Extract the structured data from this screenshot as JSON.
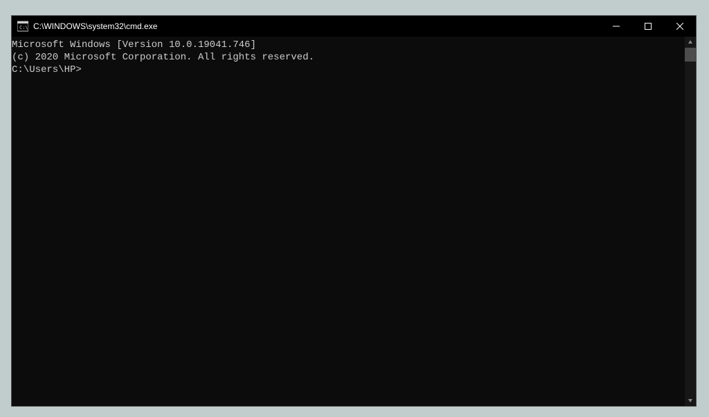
{
  "titlebar": {
    "title": "C:\\WINDOWS\\system32\\cmd.exe"
  },
  "terminal": {
    "line1": "Microsoft Windows [Version 10.0.19041.746]",
    "line2": "(c) 2020 Microsoft Corporation. All rights reserved.",
    "blank": "",
    "prompt": "C:\\Users\\HP>"
  }
}
